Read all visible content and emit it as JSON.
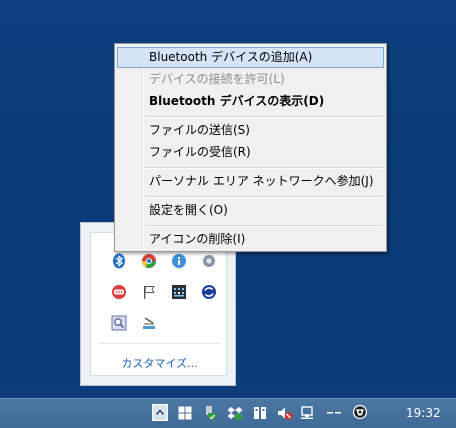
{
  "context_menu": {
    "items": [
      {
        "label": "Bluetooth デバイスの追加(A)"
      },
      {
        "label": "デバイスの接続を許可(L)"
      },
      {
        "label": "Bluetooth デバイスの表示(D)"
      },
      {
        "label": "ファイルの送信(S)"
      },
      {
        "label": "ファイルの受信(R)"
      },
      {
        "label": "パーソナル エリア ネットワークへ参加(J)"
      },
      {
        "label": "設定を開く(O)"
      },
      {
        "label": "アイコンの削除(I)"
      }
    ]
  },
  "tray_flyout": {
    "customize_label": "カスタマイズ...",
    "icons": [
      "bluetooth-icon",
      "chrome-icon",
      "info-icon",
      "settings-app-icon",
      "chat-icon",
      "flag-icon",
      "grid-app-icon",
      "sync-app-icon",
      "magnifier-icon",
      "scanner-icon"
    ]
  },
  "taskbar": {
    "clock": "19:32",
    "icons": [
      "show-hidden-icons",
      "windows-icon",
      "security-shield-icon",
      "dropbox-icon",
      "usb-device-icon",
      "mute-icon",
      "network-icon",
      "ime-icon",
      "language-icon"
    ]
  },
  "colors": {
    "desktop": "#0e3d7a",
    "menu_highlight": "#d5e4f7",
    "link": "#1d5fb5"
  }
}
